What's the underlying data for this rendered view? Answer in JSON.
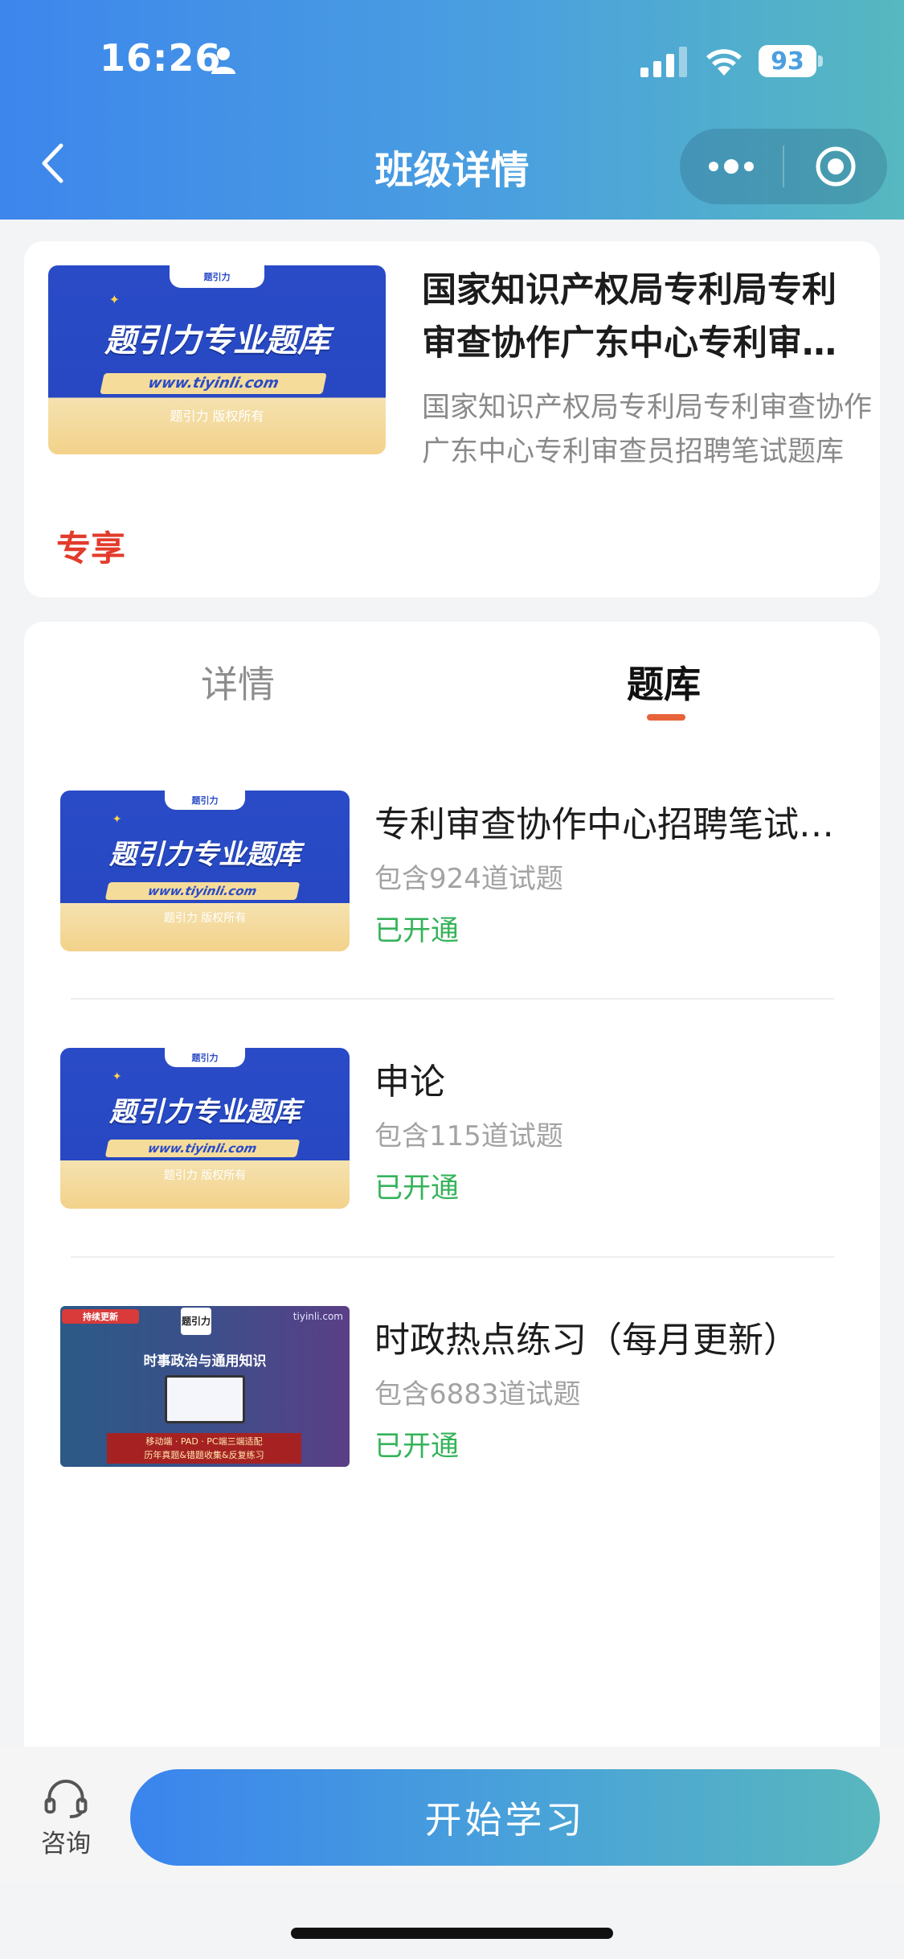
{
  "status_bar": {
    "time": "16:26",
    "battery": "93"
  },
  "nav": {
    "title": "班级详情",
    "back_icon": "chevron-left-icon",
    "more_icon": "more-dots-icon",
    "close_icon": "target-circle-icon"
  },
  "course": {
    "title": "国家知识产权局专利局专利审查协作广东中心专利审查员招聘笔试",
    "description": "国家知识产权局专利局专利审查协作广东中心专利审查员招聘笔试题库",
    "badge": "专享",
    "banner": {
      "tab": "题引力",
      "title": "题引力专业题库",
      "url": "www.tiyinli.com",
      "copyright": "题引力 版权所有"
    }
  },
  "tabs": [
    {
      "label": "详情",
      "active": false
    },
    {
      "label": "题库",
      "active": true
    }
  ],
  "question_banks": [
    {
      "name": "专利审查协作中心招聘笔试题库",
      "count": "包含924道试题",
      "status": "已开通",
      "thumb": {
        "tab": "题引力",
        "title": "题引力专业题库",
        "url": "www.tiyinli.com",
        "copyright": "题引力 版权所有"
      }
    },
    {
      "name": "申论",
      "count": "包含115道试题",
      "status": "已开通",
      "thumb": {
        "tab": "题引力",
        "title": "题引力专业题库",
        "url": "www.tiyinli.com",
        "copyright": "题引力 版权所有"
      }
    },
    {
      "name": "时政热点练习（每月更新）",
      "count": "包含6883道试题",
      "status": "已开通",
      "thumb": {
        "tag": "持续更新",
        "logo": "题引力",
        "site": "tiyinli.com",
        "title": "时事政治与通用知识",
        "footer_line1": "移动端 · PAD · PC端三端适配",
        "footer_line2": "历年真题&错题收集&反复练习"
      }
    }
  ],
  "bottom_bar": {
    "consult_label": "咨询",
    "consult_icon": "headset-icon",
    "start_button": "开始学习"
  },
  "colors": {
    "header_start": "#3d86ec",
    "header_end": "#56b8c0",
    "accent_underline": "#e8623a",
    "badge_red": "#e23b2c",
    "status_green": "#35b35a"
  }
}
